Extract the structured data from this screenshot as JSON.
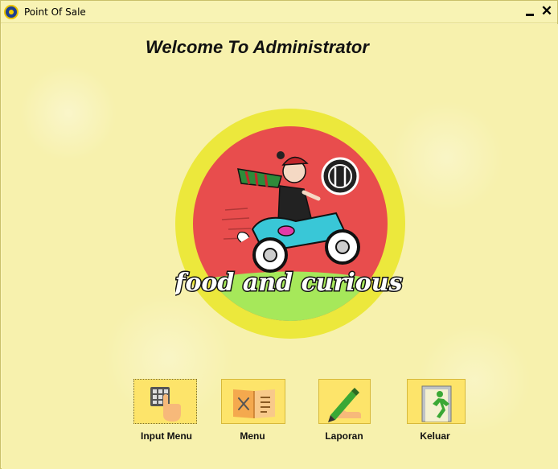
{
  "window": {
    "title": "Point Of Sale",
    "close_glyph": "✕"
  },
  "welcome_text": "Welcome To Administrator",
  "logo": {
    "text": "food and curious"
  },
  "menu": [
    {
      "label": "Input Menu",
      "icon": "keypad-touch-icon"
    },
    {
      "label": "Menu",
      "icon": "food-menu-icon"
    },
    {
      "label": "Laporan",
      "icon": "report-pen-icon"
    },
    {
      "label": "Keluar",
      "icon": "exit-door-icon"
    }
  ],
  "colors": {
    "background": "#f7f1ad",
    "button": "#fde46a",
    "logo_outer": "#e9e63b",
    "logo_inner": "#e84a4a"
  }
}
